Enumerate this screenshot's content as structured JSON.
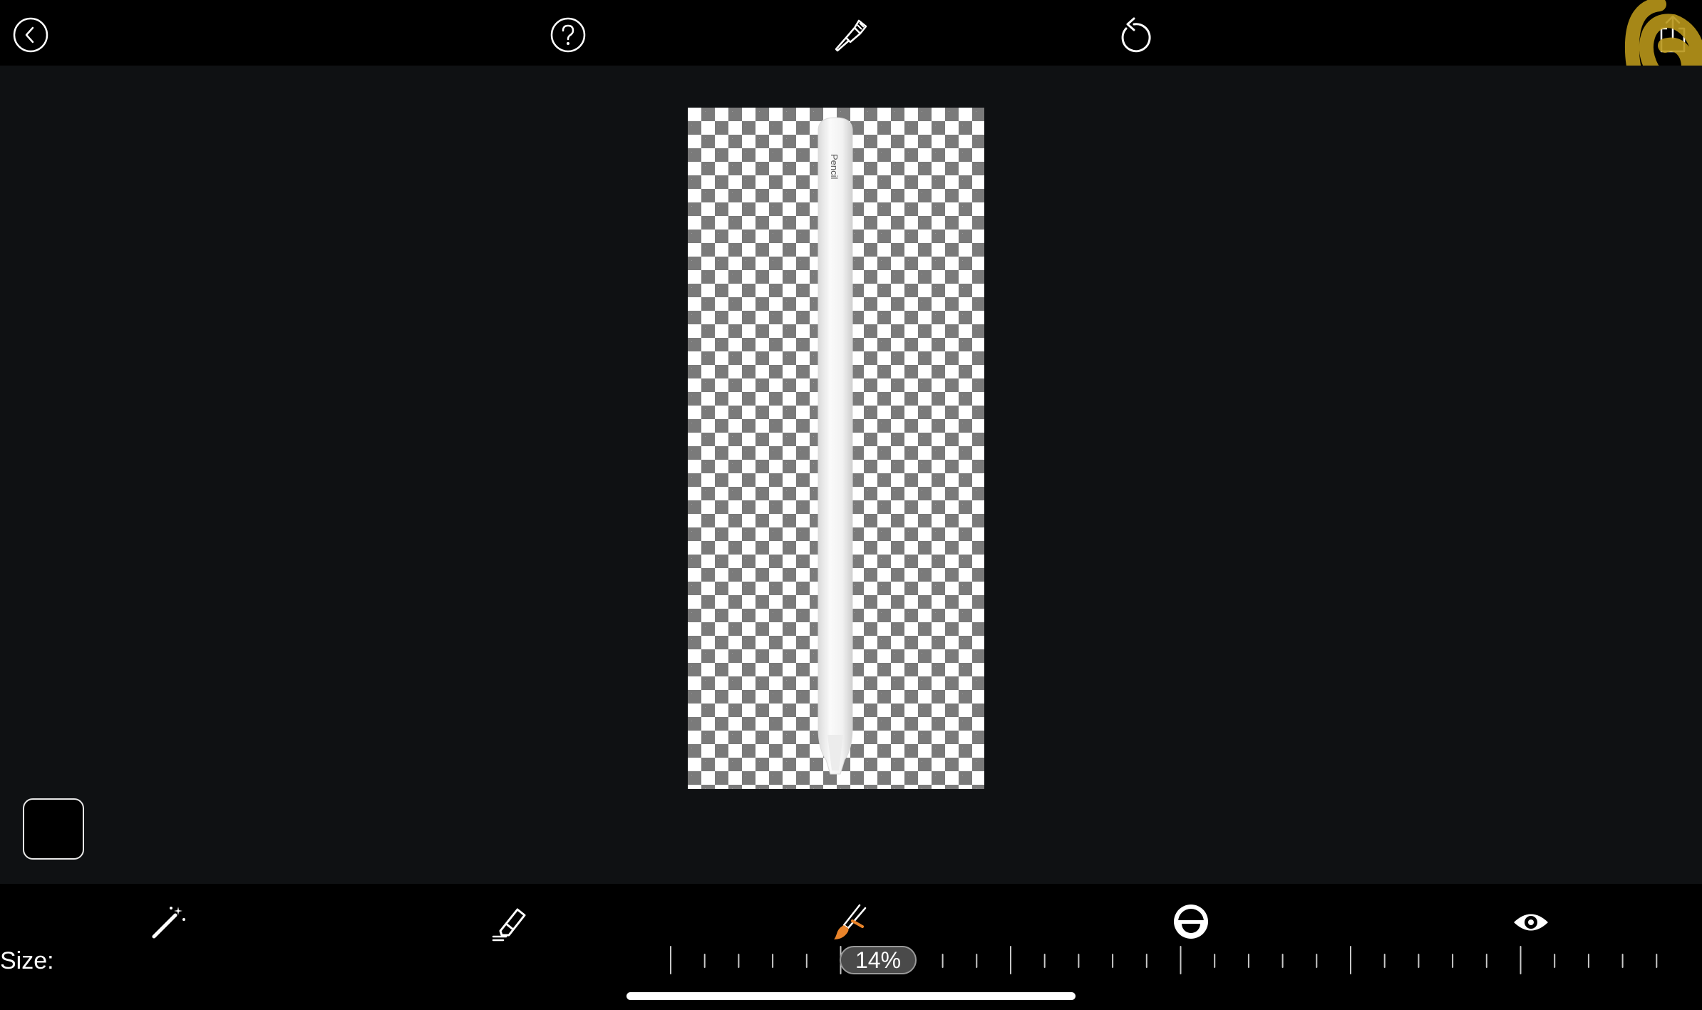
{
  "toolbar": {
    "back_icon": "chevron-left-circle-icon",
    "help_icon": "question-circle-icon",
    "tool_icon": "brush-settings-icon",
    "undo_icon": "undo-icon",
    "share_icon": "share-icon"
  },
  "canvas": {
    "image_subject": "apple-pencil",
    "pencil_label": "Pencil"
  },
  "bottom_tools": [
    {
      "name": "magic-wand-icon",
      "active": false
    },
    {
      "name": "eraser-icon",
      "active": false
    },
    {
      "name": "brush-icon",
      "active": true
    },
    {
      "name": "hardness-toggle-icon",
      "active": false
    },
    {
      "name": "preview-eye-icon",
      "active": false
    }
  ],
  "size_control": {
    "label": "Size:",
    "value": "14%"
  },
  "colors": {
    "background": "#000000",
    "canvas_bg": "#0f1113",
    "accent": "#e8832a",
    "annotation": "#b8961a"
  }
}
